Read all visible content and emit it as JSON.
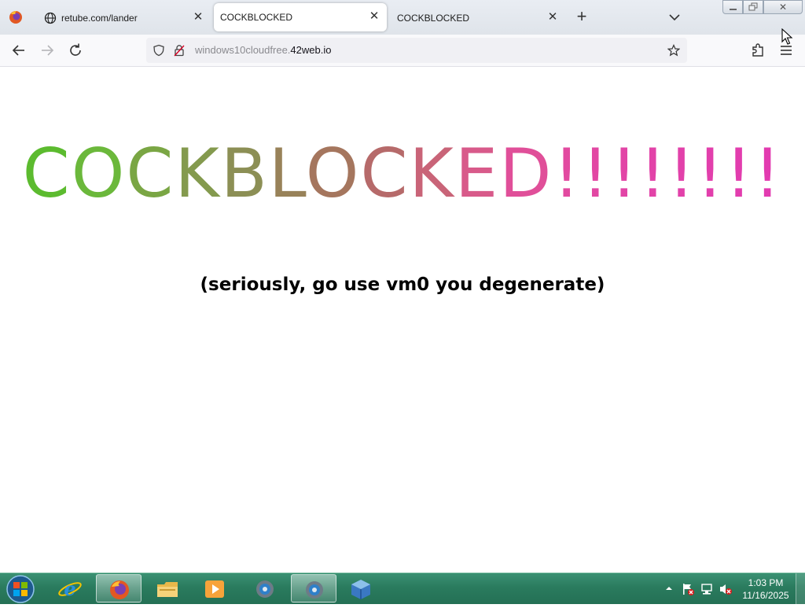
{
  "browser": {
    "tabs": [
      {
        "title": "retube.com/lander",
        "icon": "globe-icon",
        "active": false
      },
      {
        "title": "COCKBLOCKED",
        "icon": "",
        "active": true
      },
      {
        "title": "COCKBLOCKED",
        "icon": "",
        "active": false
      }
    ],
    "url": {
      "prefix": "windows10cloudfree.",
      "domain": "42web.io"
    }
  },
  "page": {
    "headline_letters": [
      "C",
      "O",
      "C",
      "K",
      "B",
      "L",
      "O",
      "C",
      "K",
      "E",
      "D",
      "!",
      "!",
      "!",
      "!",
      "!",
      "!",
      "!",
      "!"
    ],
    "headline_colors": [
      "#5cbb2f",
      "#6bb83b",
      "#7aa644",
      "#849a4e",
      "#8c8f55",
      "#988259",
      "#a5765e",
      "#b66a6a",
      "#c96478",
      "#d85a8a",
      "#e04f99",
      "#e24aa0",
      "#e247a3",
      "#e245a6",
      "#e243a8",
      "#e241aa",
      "#e23fac",
      "#e23dae",
      "#e23bb0"
    ],
    "subline": "(seriously, go use vm0 you degenerate)"
  },
  "taskbar": {
    "apps": [
      "internet-explorer-icon",
      "firefox-icon",
      "file-explorer-icon",
      "media-player-icon",
      "app-icon",
      "app-icon",
      "virtualbox-icon"
    ],
    "active_app_indices": [
      1,
      5
    ],
    "clock": {
      "time": "1:03 PM",
      "date": "11/16/2025"
    }
  },
  "colors": {
    "taskbar": "#2a7b5e",
    "tab_active_bg": "#ffffff",
    "url_domain": "#15141a"
  }
}
